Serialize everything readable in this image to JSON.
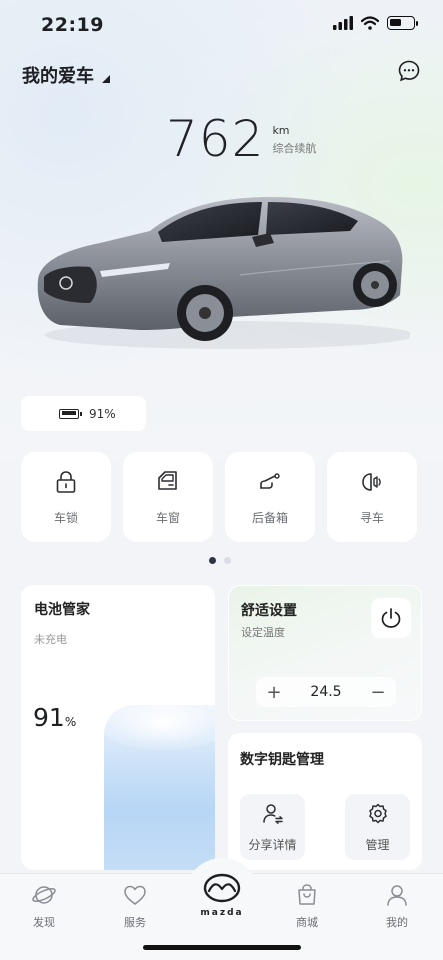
{
  "status_bar": {
    "time": "22:19"
  },
  "header": {
    "title": "我的爱车"
  },
  "range": {
    "value": "762",
    "unit": "km",
    "label": "综合续航"
  },
  "battery_pill": {
    "percent": "91%"
  },
  "quick_actions": [
    {
      "label": "车锁",
      "icon": "lock-icon"
    },
    {
      "label": "车窗",
      "icon": "car-window-icon"
    },
    {
      "label": "后备箱",
      "icon": "trunk-icon"
    },
    {
      "label": "寻车",
      "icon": "headlight-horn-icon"
    }
  ],
  "pager": {
    "pages": 2,
    "active": 0
  },
  "battery_card": {
    "title": "电池管家",
    "status": "未充电",
    "value": "91",
    "unit": "%",
    "level": 0.91
  },
  "comfort_card": {
    "title": "舒适设置",
    "subtitle": "设定温度",
    "temperature": "24.5",
    "plus": "+",
    "minus": "−"
  },
  "key_card": {
    "title": "数字钥匙管理",
    "buttons": [
      {
        "label": "分享详情",
        "icon": "share-user-icon"
      },
      {
        "label": "管理",
        "icon": "settings-gear-icon"
      }
    ]
  },
  "tab_bar": {
    "items": [
      {
        "label": "发现",
        "icon": "planet-icon"
      },
      {
        "label": "服务",
        "icon": "heart-icon"
      },
      {
        "label": "商城",
        "icon": "shopping-bag-icon"
      },
      {
        "label": "我的",
        "icon": "person-icon"
      }
    ],
    "center_logo_text": "mazda"
  },
  "colors": {
    "accent_dark": "#2b3446",
    "page_bg": "#f2f4f7",
    "battery_fill": "#b7d6f5",
    "comfort_tint": "#eaf4e8"
  }
}
